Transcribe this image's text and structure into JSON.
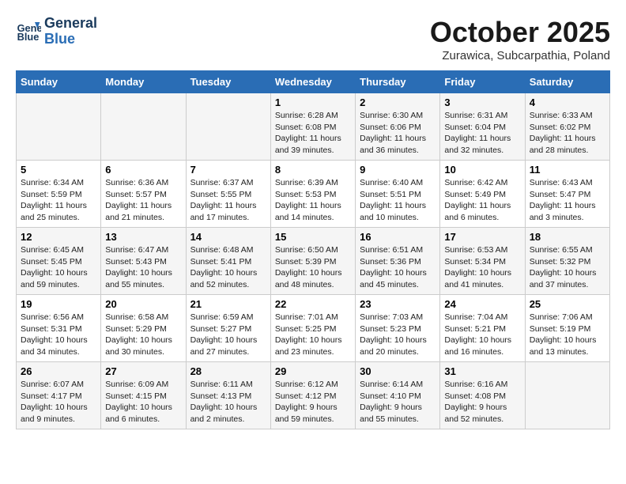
{
  "header": {
    "logo_line1": "General",
    "logo_line2": "Blue",
    "month": "October 2025",
    "location": "Zurawica, Subcarpathia, Poland"
  },
  "weekdays": [
    "Sunday",
    "Monday",
    "Tuesday",
    "Wednesday",
    "Thursday",
    "Friday",
    "Saturday"
  ],
  "weeks": [
    [
      {
        "day": "",
        "sunrise": "",
        "sunset": "",
        "daylight": ""
      },
      {
        "day": "",
        "sunrise": "",
        "sunset": "",
        "daylight": ""
      },
      {
        "day": "",
        "sunrise": "",
        "sunset": "",
        "daylight": ""
      },
      {
        "day": "1",
        "sunrise": "Sunrise: 6:28 AM",
        "sunset": "Sunset: 6:08 PM",
        "daylight": "Daylight: 11 hours and 39 minutes."
      },
      {
        "day": "2",
        "sunrise": "Sunrise: 6:30 AM",
        "sunset": "Sunset: 6:06 PM",
        "daylight": "Daylight: 11 hours and 36 minutes."
      },
      {
        "day": "3",
        "sunrise": "Sunrise: 6:31 AM",
        "sunset": "Sunset: 6:04 PM",
        "daylight": "Daylight: 11 hours and 32 minutes."
      },
      {
        "day": "4",
        "sunrise": "Sunrise: 6:33 AM",
        "sunset": "Sunset: 6:02 PM",
        "daylight": "Daylight: 11 hours and 28 minutes."
      }
    ],
    [
      {
        "day": "5",
        "sunrise": "Sunrise: 6:34 AM",
        "sunset": "Sunset: 5:59 PM",
        "daylight": "Daylight: 11 hours and 25 minutes."
      },
      {
        "day": "6",
        "sunrise": "Sunrise: 6:36 AM",
        "sunset": "Sunset: 5:57 PM",
        "daylight": "Daylight: 11 hours and 21 minutes."
      },
      {
        "day": "7",
        "sunrise": "Sunrise: 6:37 AM",
        "sunset": "Sunset: 5:55 PM",
        "daylight": "Daylight: 11 hours and 17 minutes."
      },
      {
        "day": "8",
        "sunrise": "Sunrise: 6:39 AM",
        "sunset": "Sunset: 5:53 PM",
        "daylight": "Daylight: 11 hours and 14 minutes."
      },
      {
        "day": "9",
        "sunrise": "Sunrise: 6:40 AM",
        "sunset": "Sunset: 5:51 PM",
        "daylight": "Daylight: 11 hours and 10 minutes."
      },
      {
        "day": "10",
        "sunrise": "Sunrise: 6:42 AM",
        "sunset": "Sunset: 5:49 PM",
        "daylight": "Daylight: 11 hours and 6 minutes."
      },
      {
        "day": "11",
        "sunrise": "Sunrise: 6:43 AM",
        "sunset": "Sunset: 5:47 PM",
        "daylight": "Daylight: 11 hours and 3 minutes."
      }
    ],
    [
      {
        "day": "12",
        "sunrise": "Sunrise: 6:45 AM",
        "sunset": "Sunset: 5:45 PM",
        "daylight": "Daylight: 10 hours and 59 minutes."
      },
      {
        "day": "13",
        "sunrise": "Sunrise: 6:47 AM",
        "sunset": "Sunset: 5:43 PM",
        "daylight": "Daylight: 10 hours and 55 minutes."
      },
      {
        "day": "14",
        "sunrise": "Sunrise: 6:48 AM",
        "sunset": "Sunset: 5:41 PM",
        "daylight": "Daylight: 10 hours and 52 minutes."
      },
      {
        "day": "15",
        "sunrise": "Sunrise: 6:50 AM",
        "sunset": "Sunset: 5:39 PM",
        "daylight": "Daylight: 10 hours and 48 minutes."
      },
      {
        "day": "16",
        "sunrise": "Sunrise: 6:51 AM",
        "sunset": "Sunset: 5:36 PM",
        "daylight": "Daylight: 10 hours and 45 minutes."
      },
      {
        "day": "17",
        "sunrise": "Sunrise: 6:53 AM",
        "sunset": "Sunset: 5:34 PM",
        "daylight": "Daylight: 10 hours and 41 minutes."
      },
      {
        "day": "18",
        "sunrise": "Sunrise: 6:55 AM",
        "sunset": "Sunset: 5:32 PM",
        "daylight": "Daylight: 10 hours and 37 minutes."
      }
    ],
    [
      {
        "day": "19",
        "sunrise": "Sunrise: 6:56 AM",
        "sunset": "Sunset: 5:31 PM",
        "daylight": "Daylight: 10 hours and 34 minutes."
      },
      {
        "day": "20",
        "sunrise": "Sunrise: 6:58 AM",
        "sunset": "Sunset: 5:29 PM",
        "daylight": "Daylight: 10 hours and 30 minutes."
      },
      {
        "day": "21",
        "sunrise": "Sunrise: 6:59 AM",
        "sunset": "Sunset: 5:27 PM",
        "daylight": "Daylight: 10 hours and 27 minutes."
      },
      {
        "day": "22",
        "sunrise": "Sunrise: 7:01 AM",
        "sunset": "Sunset: 5:25 PM",
        "daylight": "Daylight: 10 hours and 23 minutes."
      },
      {
        "day": "23",
        "sunrise": "Sunrise: 7:03 AM",
        "sunset": "Sunset: 5:23 PM",
        "daylight": "Daylight: 10 hours and 20 minutes."
      },
      {
        "day": "24",
        "sunrise": "Sunrise: 7:04 AM",
        "sunset": "Sunset: 5:21 PM",
        "daylight": "Daylight: 10 hours and 16 minutes."
      },
      {
        "day": "25",
        "sunrise": "Sunrise: 7:06 AM",
        "sunset": "Sunset: 5:19 PM",
        "daylight": "Daylight: 10 hours and 13 minutes."
      }
    ],
    [
      {
        "day": "26",
        "sunrise": "Sunrise: 6:07 AM",
        "sunset": "Sunset: 4:17 PM",
        "daylight": "Daylight: 10 hours and 9 minutes."
      },
      {
        "day": "27",
        "sunrise": "Sunrise: 6:09 AM",
        "sunset": "Sunset: 4:15 PM",
        "daylight": "Daylight: 10 hours and 6 minutes."
      },
      {
        "day": "28",
        "sunrise": "Sunrise: 6:11 AM",
        "sunset": "Sunset: 4:13 PM",
        "daylight": "Daylight: 10 hours and 2 minutes."
      },
      {
        "day": "29",
        "sunrise": "Sunrise: 6:12 AM",
        "sunset": "Sunset: 4:12 PM",
        "daylight": "Daylight: 9 hours and 59 minutes."
      },
      {
        "day": "30",
        "sunrise": "Sunrise: 6:14 AM",
        "sunset": "Sunset: 4:10 PM",
        "daylight": "Daylight: 9 hours and 55 minutes."
      },
      {
        "day": "31",
        "sunrise": "Sunrise: 6:16 AM",
        "sunset": "Sunset: 4:08 PM",
        "daylight": "Daylight: 9 hours and 52 minutes."
      },
      {
        "day": "",
        "sunrise": "",
        "sunset": "",
        "daylight": ""
      }
    ]
  ]
}
